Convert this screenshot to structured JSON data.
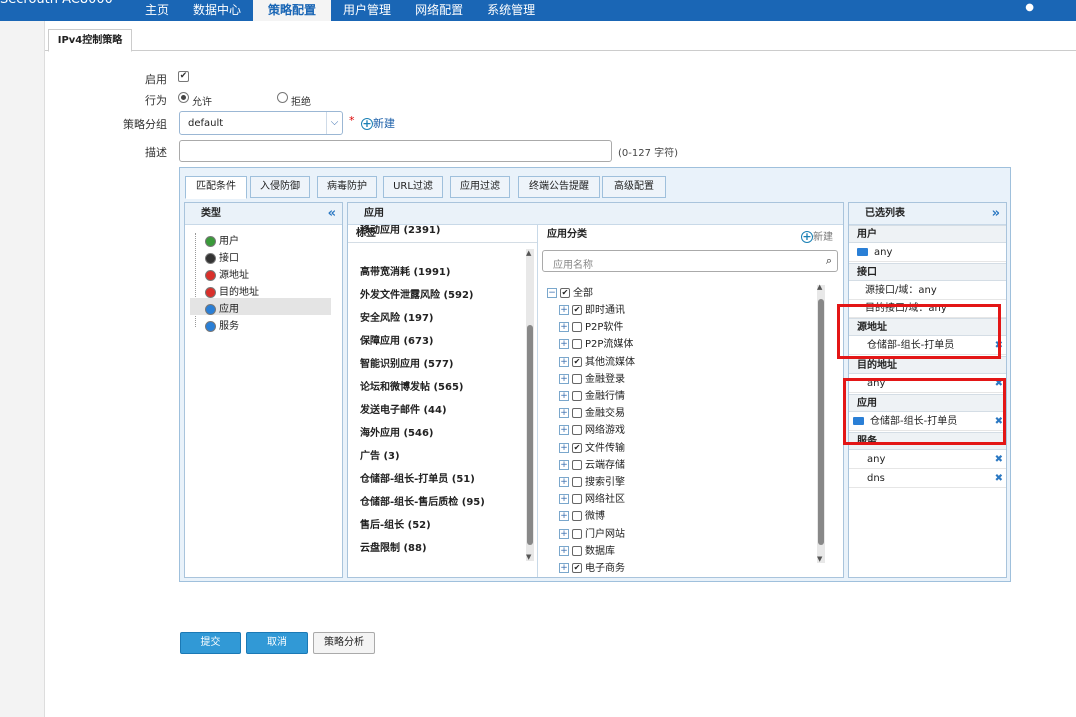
{
  "app": {
    "brand": "Secrouth AC8000"
  },
  "nav": {
    "items": [
      "主页",
      "数据中心",
      "策略配置",
      "用户管理",
      "网络配置",
      "系统管理"
    ],
    "active_index": 2
  },
  "page_tab": "IPv4控制策略",
  "form": {
    "enable_label": "启用",
    "enable_checked": true,
    "action_label": "行为",
    "allow_label": "允许",
    "deny_label": "拒绝",
    "group_label": "策略分组",
    "group_value": "default",
    "required_mark": "*",
    "new_label": "新建",
    "desc_label": "描述",
    "desc_value": "",
    "desc_hint": "(0-127 字符)"
  },
  "config_tabs": [
    "匹配条件",
    "入侵防御",
    "病毒防护",
    "URL过滤",
    "应用过滤",
    "终端公告提醒",
    "高级配置"
  ],
  "type_panel": {
    "title": "类型",
    "collapse": "«",
    "items": [
      "用户",
      "接口",
      "源地址",
      "目的地址",
      "应用",
      "服务"
    ],
    "selected_index": 4
  },
  "app_panel": {
    "title": "应用",
    "tags_header": "标签",
    "tags": [
      "移动应用 (2391)",
      "高带宽消耗 (1991)",
      "外发文件泄露风险 (592)",
      "安全风险 (197)",
      "保障应用 (673)",
      "智能识别应用 (577)",
      "论坛和微博发帖 (565)",
      "发送电子邮件 (44)",
      "海外应用 (546)",
      "广告 (3)",
      "仓储部-组长-打单员 (51)",
      "仓储部-组长-售后质检 (95)",
      "售后-组长 (52)",
      "云盘限制 (88)"
    ],
    "category_header": "应用分类",
    "category_new": "新建",
    "search_placeholder": "应用名称",
    "root": {
      "label": "全部",
      "checked": true
    },
    "categories": [
      {
        "label": "即时通讯",
        "checked": true
      },
      {
        "label": "P2P软件",
        "checked": false
      },
      {
        "label": "P2P流媒体",
        "checked": false
      },
      {
        "label": "其他流媒体",
        "checked": true
      },
      {
        "label": "金融登录",
        "checked": false
      },
      {
        "label": "金融行情",
        "checked": false
      },
      {
        "label": "金融交易",
        "checked": false
      },
      {
        "label": "网络游戏",
        "checked": false
      },
      {
        "label": "文件传输",
        "checked": true
      },
      {
        "label": "云端存储",
        "checked": false
      },
      {
        "label": "搜索引擎",
        "checked": false
      },
      {
        "label": "网络社区",
        "checked": false
      },
      {
        "label": "微博",
        "checked": false
      },
      {
        "label": "门户网站",
        "checked": false
      },
      {
        "label": "数据库",
        "checked": false
      },
      {
        "label": "电子商务",
        "checked": true
      }
    ]
  },
  "selected_panel": {
    "title": "已选列表",
    "expand": "»",
    "user_title": "用户",
    "user_value": "any",
    "iface_title": "接口",
    "src_iface": "源接口/域：any",
    "dst_iface": "目的接口/域：any",
    "src_title": "源地址",
    "src_value": "仓储部-组长-打单员",
    "dst_title": "目的地址",
    "dst_value": "any",
    "app_title": "应用",
    "app_value": "仓储部-组长-打单员",
    "svc_title": "服务",
    "svc_values": [
      "any",
      "dns"
    ],
    "remove_icon": "✖"
  },
  "buttons": {
    "submit": "提交",
    "cancel": "取消",
    "analyze": "策略分析"
  },
  "colors": {
    "nav_bg": "#1a66b5",
    "highlight_box": "#e31616",
    "button_blue": "#3199d6"
  }
}
